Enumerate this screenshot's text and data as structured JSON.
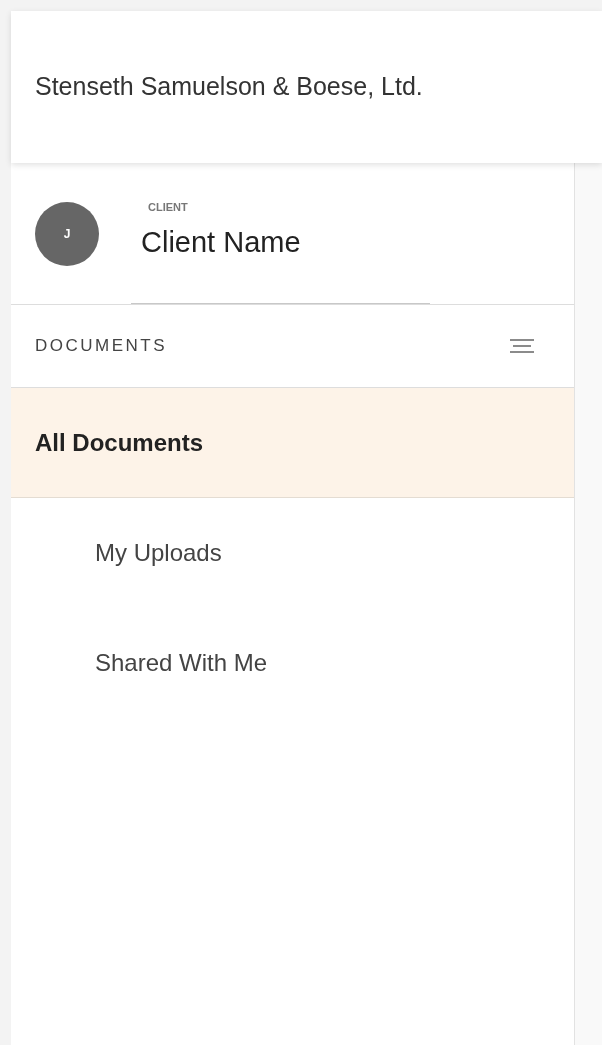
{
  "header": {
    "title": "Stenseth Samuelson & Boese, Ltd."
  },
  "client": {
    "avatar": "J",
    "label": "CLIENT",
    "name": "Client Name"
  },
  "documents": {
    "heading": "DOCUMENTS",
    "items": [
      {
        "label": "All Documents",
        "selected": true,
        "kind": "top"
      },
      {
        "label": "My Uploads",
        "selected": false,
        "kind": "sub"
      },
      {
        "label": "Shared With Me",
        "selected": false,
        "kind": "sub"
      }
    ]
  }
}
